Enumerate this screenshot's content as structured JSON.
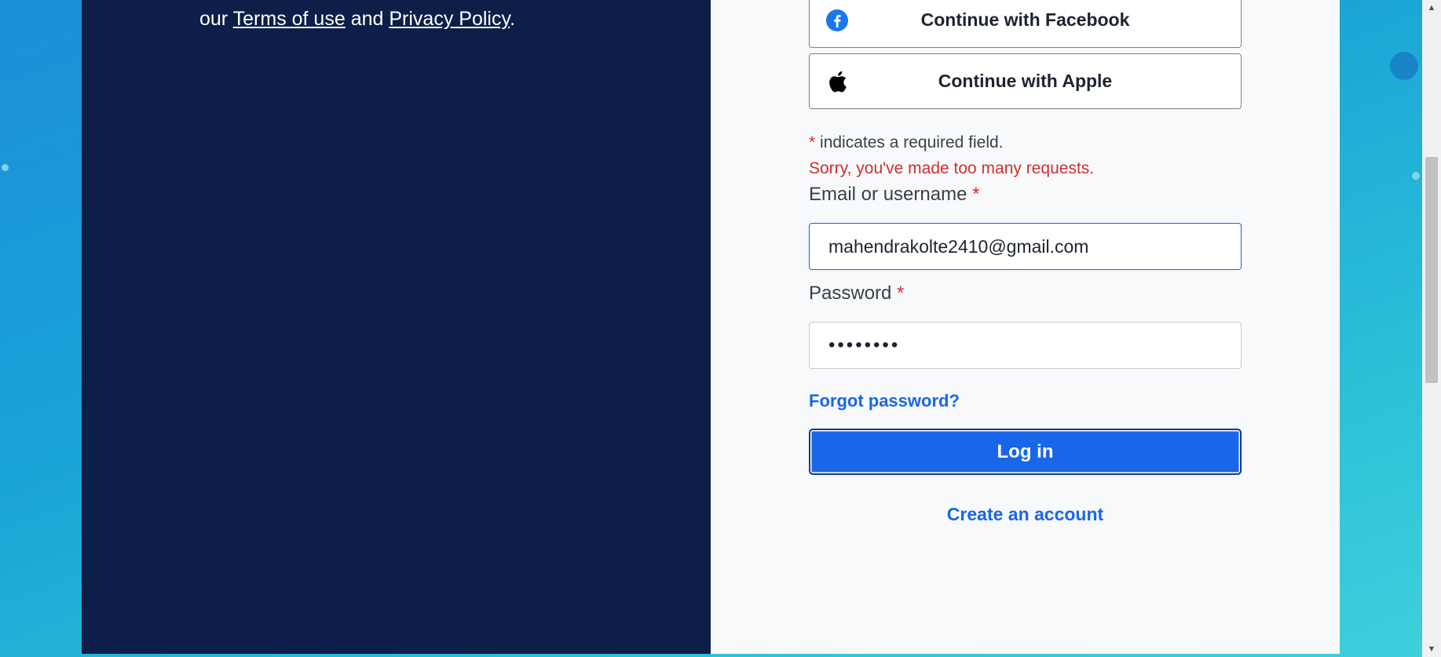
{
  "legal": {
    "prefix": "our ",
    "terms_link": "Terms of use",
    "conjunction": " and ",
    "privacy_link": "Privacy Policy",
    "suffix": "."
  },
  "social": {
    "facebook_label": "Continue with Facebook",
    "apple_label": "Continue with Apple",
    "facebook_icon": "facebook-icon",
    "apple_icon": "apple-icon"
  },
  "form": {
    "required_marker": "*",
    "required_note": " indicates a required field.",
    "error_message": "Sorry, you've made too many requests.",
    "email_label": "Email or username",
    "email_value": "mahendrakolte2410@gmail.com",
    "password_label": "Password",
    "password_value": "••••••••",
    "forgot_link": "Forgot password?",
    "login_button": "Log in",
    "create_account_link": "Create an account"
  },
  "colors": {
    "accent": "#1a66e8",
    "error": "#d32f2f",
    "left_panel": "#0d1f49",
    "right_panel": "#f7f9fb"
  }
}
